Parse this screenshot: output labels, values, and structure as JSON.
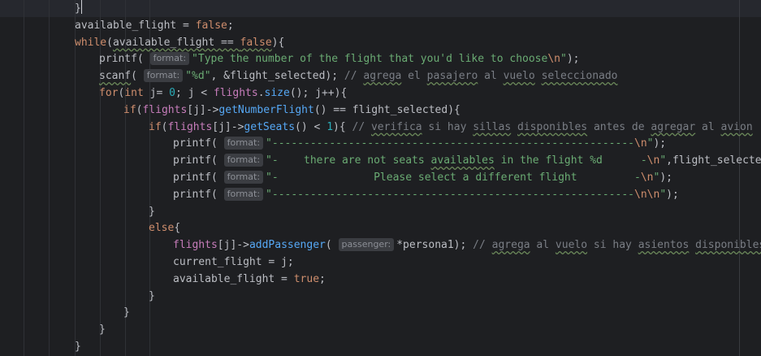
{
  "lines": [
    {
      "tokens": [
        {
          "t": "}",
          "c": "plain"
        }
      ]
    },
    {
      "tokens": [
        {
          "t": "available_flight = ",
          "c": "plain"
        },
        {
          "t": "false",
          "c": "kw"
        },
        {
          "t": ";",
          "c": "plain"
        }
      ]
    },
    {
      "tokens": [
        {
          "t": "while",
          "c": "kw"
        },
        {
          "t": "(",
          "c": "plain"
        },
        {
          "t": "available_flight == ",
          "c": "plain",
          "u": 1
        },
        {
          "t": "false",
          "c": "kw",
          "u": 1
        },
        {
          "t": "){",
          "c": "plain"
        }
      ]
    },
    {
      "tokens": [
        {
          "t": "printf",
          "c": "plain"
        },
        {
          "t": "( ",
          "c": "plain"
        },
        {
          "h": "format:"
        },
        {
          "t": "\"Type the number of the flight that you'd like to choose",
          "c": "str"
        },
        {
          "t": "\\n",
          "c": "esc"
        },
        {
          "t": "\"",
          "c": "str"
        },
        {
          "t": ");",
          "c": "plain"
        }
      ]
    },
    {
      "tokens": [
        {
          "t": "scanf",
          "c": "plain",
          "u": 1
        },
        {
          "t": "( ",
          "c": "plain"
        },
        {
          "h": "format:"
        },
        {
          "t": "\"%d\"",
          "c": "str"
        },
        {
          "t": ", &flight_selected); ",
          "c": "plain"
        },
        {
          "t": "// ",
          "c": "cmt"
        },
        {
          "t": "agrega",
          "c": "cmt",
          "u": 1
        },
        {
          "t": " el ",
          "c": "cmt"
        },
        {
          "t": "pasajero",
          "c": "cmt",
          "u": 1
        },
        {
          "t": " al ",
          "c": "cmt"
        },
        {
          "t": "vuelo",
          "c": "cmt",
          "u": 1
        },
        {
          "t": " ",
          "c": "cmt"
        },
        {
          "t": "seleccionado",
          "c": "cmt",
          "u": 1
        }
      ]
    },
    {
      "tokens": [
        {
          "t": "for",
          "c": "kw"
        },
        {
          "t": "(",
          "c": "plain"
        },
        {
          "t": "int",
          "c": "kw"
        },
        {
          "t": " j= ",
          "c": "plain"
        },
        {
          "t": "0",
          "c": "num"
        },
        {
          "t": "; j < ",
          "c": "plain"
        },
        {
          "t": "flights",
          "c": "var"
        },
        {
          "t": ".",
          "c": "plain"
        },
        {
          "t": "size",
          "c": "fn"
        },
        {
          "t": "(); j++){",
          "c": "plain"
        }
      ]
    },
    {
      "tokens": [
        {
          "t": "if",
          "c": "kw"
        },
        {
          "t": "(",
          "c": "plain"
        },
        {
          "t": "flights",
          "c": "var"
        },
        {
          "t": "[j]->",
          "c": "plain"
        },
        {
          "t": "getNumberFlight",
          "c": "fn"
        },
        {
          "t": "() == flight_selected){",
          "c": "plain"
        }
      ]
    },
    {
      "tokens": [
        {
          "t": "if",
          "c": "kw"
        },
        {
          "t": "(",
          "c": "plain"
        },
        {
          "t": "flights",
          "c": "var"
        },
        {
          "t": "[j]->",
          "c": "plain"
        },
        {
          "t": "getSeats",
          "c": "fn"
        },
        {
          "t": "() < ",
          "c": "plain"
        },
        {
          "t": "1",
          "c": "num"
        },
        {
          "t": "){ ",
          "c": "plain"
        },
        {
          "t": "// ",
          "c": "cmt"
        },
        {
          "t": "verifica",
          "c": "cmt",
          "u": 1
        },
        {
          "t": " si hay ",
          "c": "cmt"
        },
        {
          "t": "sillas",
          "c": "cmt",
          "u": 1
        },
        {
          "t": " ",
          "c": "cmt"
        },
        {
          "t": "disponibles",
          "c": "cmt",
          "u": 1
        },
        {
          "t": " antes de ",
          "c": "cmt"
        },
        {
          "t": "agregar",
          "c": "cmt",
          "u": 1
        },
        {
          "t": " al ",
          "c": "cmt"
        },
        {
          "t": "avion",
          "c": "cmt",
          "u": 1
        }
      ]
    },
    {
      "tokens": [
        {
          "t": "printf",
          "c": "plain"
        },
        {
          "t": "( ",
          "c": "plain"
        },
        {
          "h": "format:"
        },
        {
          "t": "\"---------------------------------------------------------",
          "c": "str"
        },
        {
          "t": "\\n",
          "c": "esc"
        },
        {
          "t": "\"",
          "c": "str"
        },
        {
          "t": ");",
          "c": "plain"
        }
      ]
    },
    {
      "tokens": [
        {
          "t": "printf",
          "c": "plain"
        },
        {
          "t": "( ",
          "c": "plain"
        },
        {
          "h": "format:"
        },
        {
          "t": "\"-    there are not seats ",
          "c": "str"
        },
        {
          "t": "availables",
          "c": "str",
          "u": 1
        },
        {
          "t": " in the flight %d      -",
          "c": "str"
        },
        {
          "t": "\\n",
          "c": "esc"
        },
        {
          "t": "\"",
          "c": "str"
        },
        {
          "t": ",flight_selected);",
          "c": "plain"
        }
      ]
    },
    {
      "tokens": [
        {
          "t": "printf",
          "c": "plain"
        },
        {
          "t": "( ",
          "c": "plain"
        },
        {
          "h": "format:"
        },
        {
          "t": "\"-               Please select a different flight         -",
          "c": "str"
        },
        {
          "t": "\\n",
          "c": "esc"
        },
        {
          "t": "\"",
          "c": "str"
        },
        {
          "t": ");",
          "c": "plain"
        }
      ]
    },
    {
      "tokens": [
        {
          "t": "printf",
          "c": "plain"
        },
        {
          "t": "( ",
          "c": "plain"
        },
        {
          "h": "format:"
        },
        {
          "t": "\"---------------------------------------------------------",
          "c": "str"
        },
        {
          "t": "\\n\\n",
          "c": "esc"
        },
        {
          "t": "\"",
          "c": "str"
        },
        {
          "t": ");",
          "c": "plain"
        }
      ]
    },
    {
      "tokens": [
        {
          "t": "}",
          "c": "plain"
        }
      ]
    },
    {
      "tokens": [
        {
          "t": "else",
          "c": "kw"
        },
        {
          "t": "{",
          "c": "plain"
        }
      ]
    },
    {
      "tokens": [
        {
          "t": "flights",
          "c": "var"
        },
        {
          "t": "[j]->",
          "c": "plain"
        },
        {
          "t": "addPassenger",
          "c": "fn"
        },
        {
          "t": "( ",
          "c": "plain"
        },
        {
          "h": "passenger:"
        },
        {
          "t": "*persona1); ",
          "c": "plain"
        },
        {
          "t": "// ",
          "c": "cmt"
        },
        {
          "t": "agrega",
          "c": "cmt",
          "u": 1
        },
        {
          "t": " al ",
          "c": "cmt"
        },
        {
          "t": "vuelo",
          "c": "cmt",
          "u": 1
        },
        {
          "t": " si hay ",
          "c": "cmt"
        },
        {
          "t": "asientos",
          "c": "cmt",
          "u": 1
        },
        {
          "t": " ",
          "c": "cmt"
        },
        {
          "t": "disponibles",
          "c": "cmt",
          "u": 1
        }
      ]
    },
    {
      "tokens": [
        {
          "t": "current_flight = j;",
          "c": "plain"
        }
      ]
    },
    {
      "tokens": [
        {
          "t": "available_flight = ",
          "c": "plain"
        },
        {
          "t": "true",
          "c": "kw"
        },
        {
          "t": ";",
          "c": "plain"
        }
      ]
    },
    {
      "tokens": [
        {
          "t": "}",
          "c": "plain"
        }
      ]
    },
    {
      "tokens": [
        {
          "t": "}",
          "c": "plain"
        }
      ]
    },
    {
      "tokens": [
        {
          "t": "}",
          "c": "plain"
        }
      ]
    },
    {
      "tokens": [
        {
          "t": "}",
          "c": "plain"
        }
      ]
    }
  ]
}
